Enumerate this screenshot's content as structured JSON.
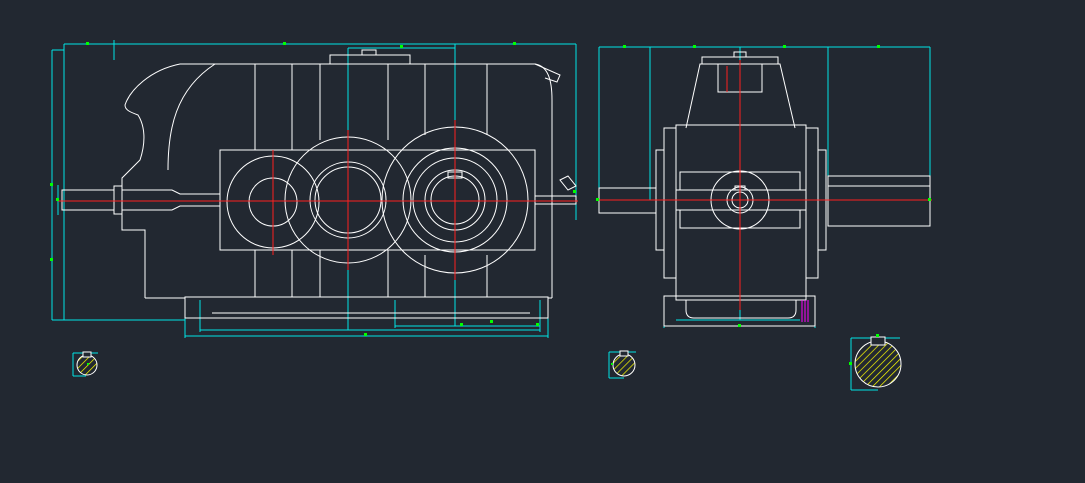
{
  "drawing": {
    "background": "#222831",
    "colors": {
      "outline": "#ffffff",
      "dimension": "#00e5e5",
      "centerline": "#ff2020",
      "grip": "#00ff00",
      "hatch": "#ffff00",
      "accent": "#ff00ff"
    },
    "views": [
      "front-view",
      "side-view",
      "shaft-section-small-left",
      "shaft-section-small-middle",
      "shaft-section-large-right"
    ]
  }
}
